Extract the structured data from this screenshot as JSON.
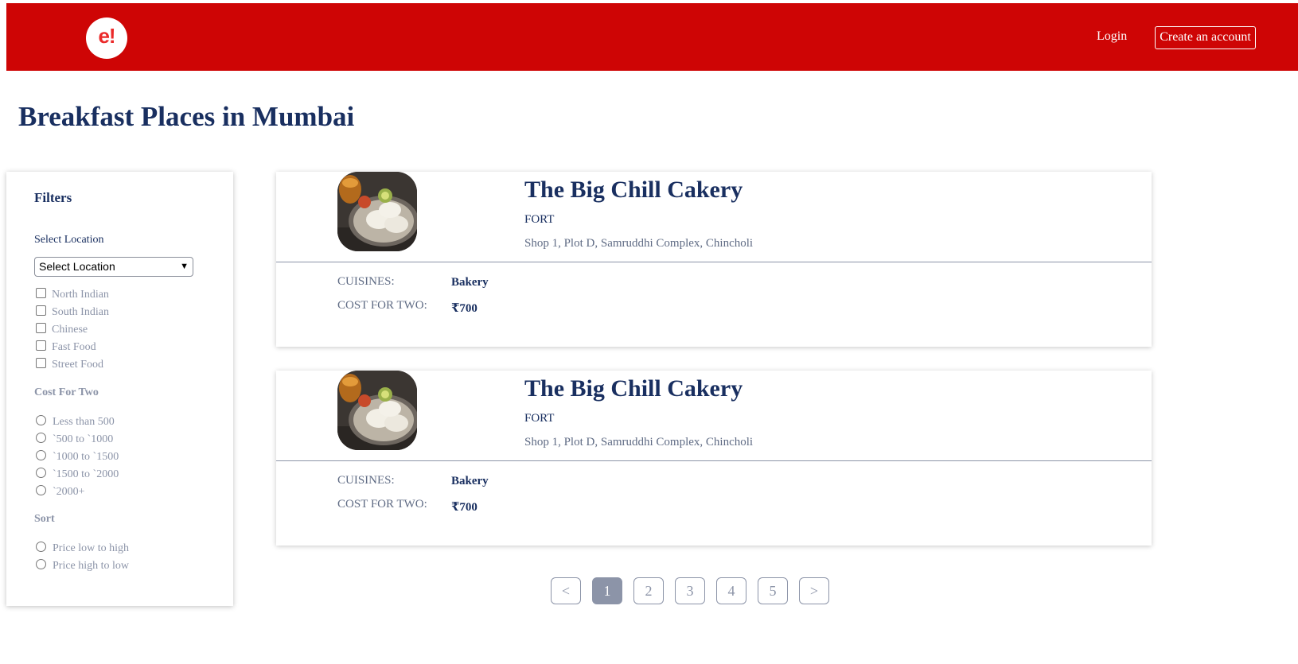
{
  "header": {
    "logo_text": "e!",
    "login_label": "Login",
    "create_account_label": "Create an account",
    "bg_color": "#ce0505"
  },
  "page_title": "Breakfast Places in Mumbai",
  "filters": {
    "title": "Filters",
    "location_label": "Select Location",
    "location_selected": "Select Location",
    "cuisines": [
      "North Indian",
      "South Indian",
      "Chinese",
      "Fast Food",
      "Street Food"
    ],
    "cost_title": "Cost For Two",
    "cost_options": [
      "Less than 500",
      "`500 to `1000",
      "`1000 to `1500",
      "`1500 to `2000",
      "`2000+"
    ],
    "sort_title": "Sort",
    "sort_options": [
      "Price low to high",
      "Price high to low"
    ]
  },
  "restaurants": [
    {
      "name": "The Big Chill Cakery",
      "area": "FORT",
      "address": "Shop 1, Plot D, Samruddhi Complex, Chincholi",
      "cuisines_label": "CUISINES:",
      "cuisines_value": "Bakery",
      "cost_label": "COST FOR TWO:",
      "cost_value": "₹700"
    },
    {
      "name": "The Big Chill Cakery",
      "area": "FORT",
      "address": "Shop 1, Plot D, Samruddhi Complex, Chincholi",
      "cuisines_label": "CUISINES:",
      "cuisines_value": "Bakery",
      "cost_label": "COST FOR TWO:",
      "cost_value": "₹700"
    }
  ],
  "pagination": {
    "prev": "<",
    "pages": [
      "1",
      "2",
      "3",
      "4",
      "5"
    ],
    "next": ">",
    "current": "1"
  }
}
